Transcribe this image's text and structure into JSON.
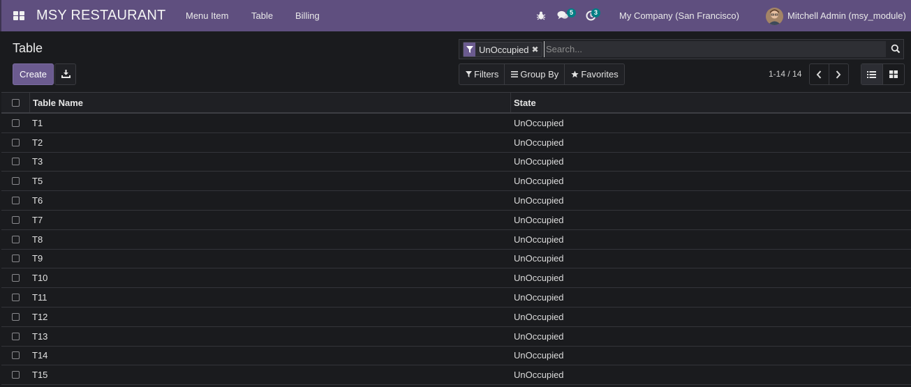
{
  "app": {
    "brand": "MSY RESTAURANT",
    "menus": [
      {
        "label": "Menu Item"
      },
      {
        "label": "Table"
      },
      {
        "label": "Billing"
      }
    ],
    "messages_count": "5",
    "activities_count": "3",
    "company": "My Company (San Francisco)",
    "user": "Mitchell Admin (msy_module)"
  },
  "page": {
    "title": "Table",
    "create_label": "Create"
  },
  "search": {
    "facet": "UnOccupied",
    "placeholder": "Search...",
    "filters_label": "Filters",
    "groupby_label": "Group By",
    "favorites_label": "Favorites"
  },
  "pager": {
    "value": "1-14 / 14"
  },
  "table": {
    "columns": [
      "Table Name",
      "State"
    ],
    "rows": [
      {
        "name": "T1",
        "state": "UnOccupied"
      },
      {
        "name": "T2",
        "state": "UnOccupied"
      },
      {
        "name": "T3",
        "state": "UnOccupied"
      },
      {
        "name": "T5",
        "state": "UnOccupied"
      },
      {
        "name": "T6",
        "state": "UnOccupied"
      },
      {
        "name": "T7",
        "state": "UnOccupied"
      },
      {
        "name": "T8",
        "state": "UnOccupied"
      },
      {
        "name": "T9",
        "state": "UnOccupied"
      },
      {
        "name": "T10",
        "state": "UnOccupied"
      },
      {
        "name": "T11",
        "state": "UnOccupied"
      },
      {
        "name": "T12",
        "state": "UnOccupied"
      },
      {
        "name": "T13",
        "state": "UnOccupied"
      },
      {
        "name": "T14",
        "state": "UnOccupied"
      },
      {
        "name": "T15",
        "state": "UnOccupied"
      }
    ]
  },
  "colors": {
    "navbar": "#5f4f7f",
    "primary_button": "#6b5b8f",
    "badge": "#017e84",
    "background": "#1a1b1e"
  },
  "icons": {
    "apps": "apps-grid-icon",
    "debug": "bug-icon",
    "messages": "chat-icon",
    "activities": "clock-icon",
    "download": "download-icon",
    "search": "search-icon",
    "filter": "filter-icon",
    "group_by": "list-icon",
    "favorites": "star-icon",
    "prev": "chevron-left-icon",
    "next": "chevron-right-icon",
    "list_view": "list-view-icon",
    "kanban_view": "kanban-view-icon"
  }
}
